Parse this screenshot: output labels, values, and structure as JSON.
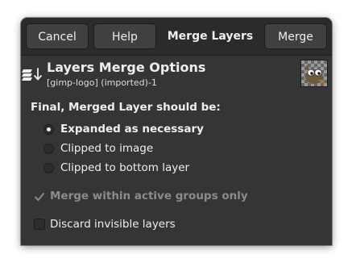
{
  "header": {
    "cancel_label": "Cancel",
    "help_label": "Help",
    "title": "Merge Layers",
    "merge_label": "Merge"
  },
  "options": {
    "title": "Layers Merge Options",
    "subtitle": "[gimp-logo] (imported)-1",
    "thumbnail_icon": "gimp-wilber-thumbnail"
  },
  "final_layer": {
    "label": "Final, Merged Layer should be:",
    "choices": [
      {
        "label": "Expanded as necessary",
        "selected": true
      },
      {
        "label": "Clipped to image",
        "selected": false
      },
      {
        "label": "Clipped to bottom layer",
        "selected": false
      }
    ]
  },
  "checks": {
    "merge_groups": {
      "label": "Merge within active groups only",
      "checked": true,
      "enabled": false
    },
    "discard_invisible": {
      "label": "Discard invisible layers",
      "checked": false,
      "enabled": true
    }
  },
  "colors": {
    "dialog_bg": "#353535",
    "header_bg": "#2b2b2b",
    "text": "#eeeeec",
    "disabled_text": "#8b8b8b"
  }
}
